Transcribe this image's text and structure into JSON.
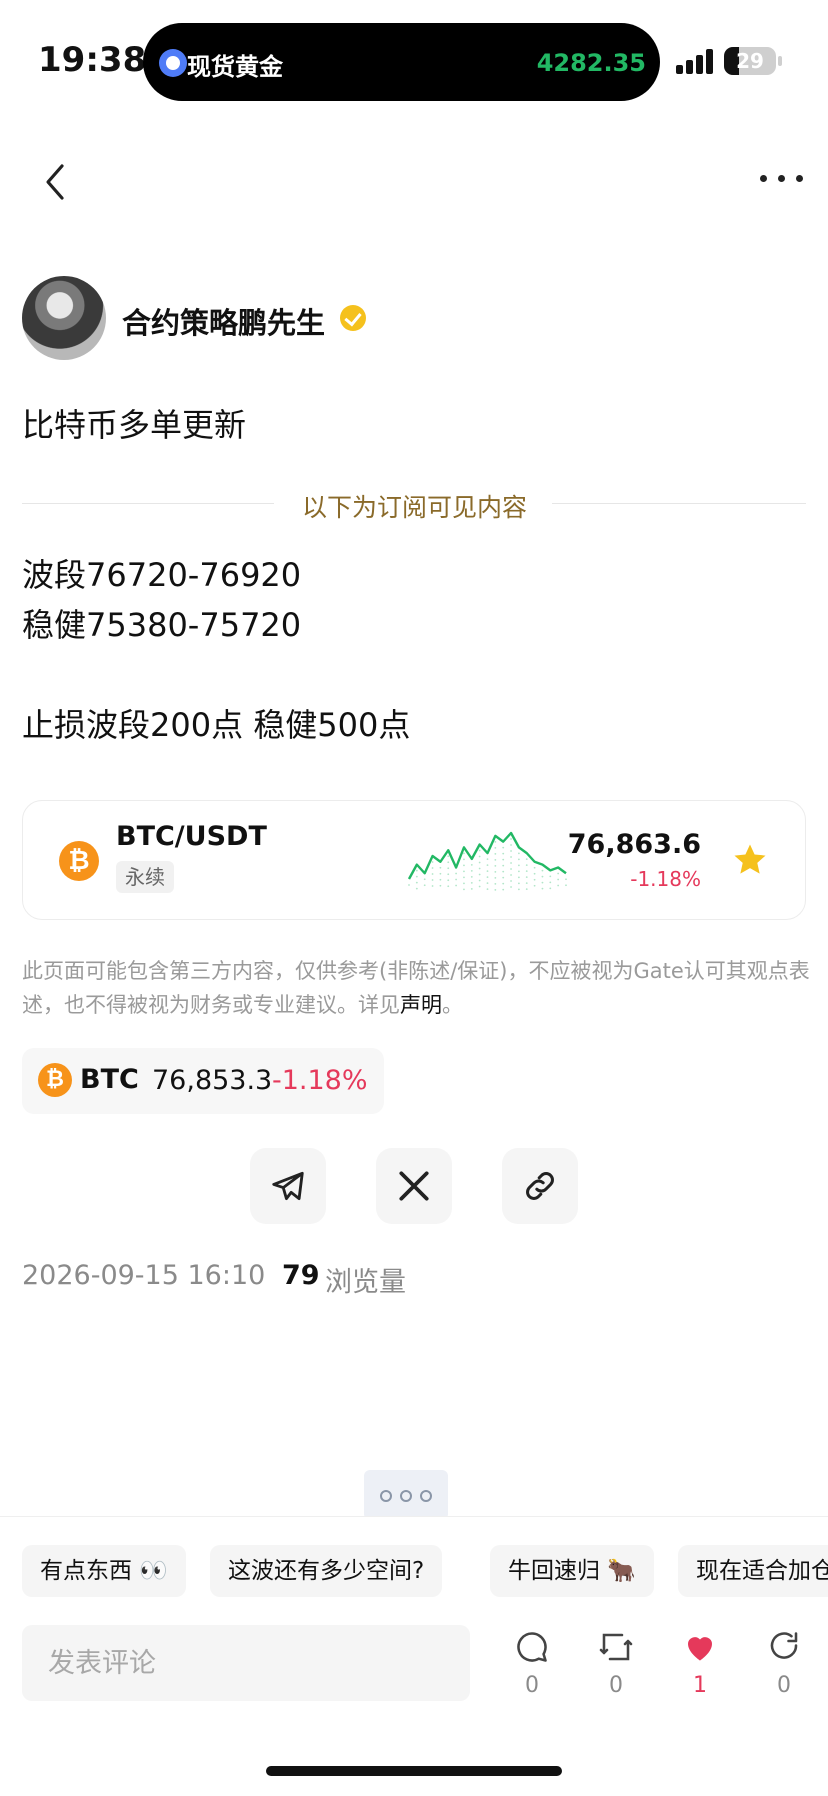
{
  "status_bar": {
    "time": "19:38",
    "live_activity_title": "现货黄金",
    "live_activity_price": "4282.35",
    "battery": "29",
    "battery_level": 0.29
  },
  "author": {
    "name": "合约策略鹏先生",
    "verified": true
  },
  "post": {
    "title": "比特币多单更新",
    "subscriber_divider": "以下为订阅可见内容",
    "lines": [
      "波段76720-76920",
      "稳健75380-75720",
      "止损波段200点 稳健500点"
    ]
  },
  "market_card": {
    "pair": "BTC/USDT",
    "tag": "永续",
    "price": "76,863.6",
    "change": "-1.18%",
    "favorited": true,
    "sparkline": [
      40,
      30,
      36,
      24,
      28,
      20,
      32,
      18,
      26,
      16,
      22,
      10,
      14,
      8,
      18,
      22,
      28,
      30,
      34,
      32,
      36
    ]
  },
  "disclaimer": {
    "text": "此页面可能包含第三方内容，仅供参考(非陈述/保证)，不应被视为Gate认可其观点表述，也不得被视为财务或专业建议。详见",
    "link": "声明",
    "end": "。"
  },
  "ticker": {
    "symbol": "BTC",
    "price": "76,853.3",
    "change": "-1.18%"
  },
  "meta": {
    "date": "2026-09-15 16:10",
    "views": "79",
    "views_label": "浏览量"
  },
  "quick_replies": [
    "有点东西 👀",
    "这波还有多少空间?",
    "牛回速归 🐂",
    "现在适合加仓"
  ],
  "comment": {
    "placeholder": "发表评论"
  },
  "actions": {
    "comments": "0",
    "reposts": "0",
    "likes": "1",
    "shares": "0"
  },
  "colors": {
    "up": "#22b864",
    "down": "#e5395b",
    "brand_gold": "#f5c11d",
    "btc": "#f7931a"
  }
}
